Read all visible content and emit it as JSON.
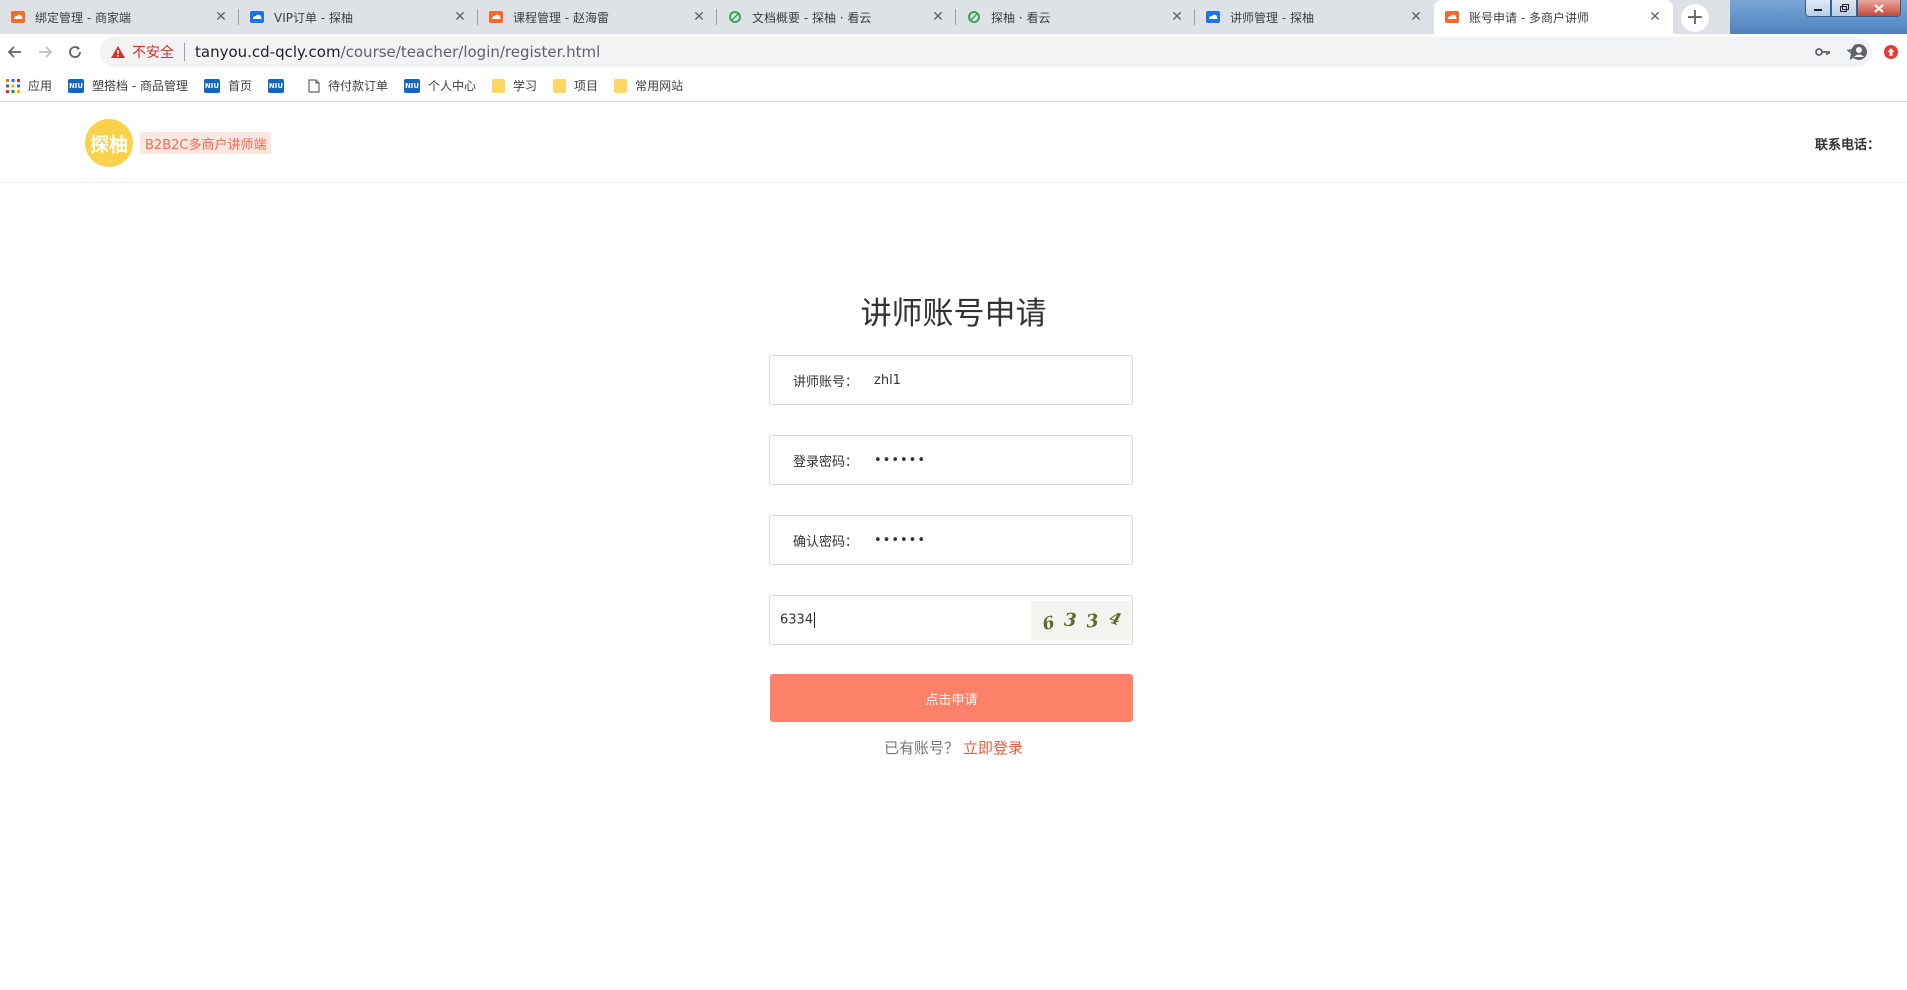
{
  "browser": {
    "tabs": [
      {
        "title": "绑定管理 - 商家端",
        "icon": "orange-cloud-icon",
        "active": false
      },
      {
        "title": "VIP订单 - 探柚",
        "icon": "blue-cloud-icon",
        "active": false
      },
      {
        "title": "课程管理 - 赵海雷",
        "icon": "orange-cloud-icon",
        "active": false
      },
      {
        "title": "文档概要 - 探柚 · 看云",
        "icon": "green-leaf-icon",
        "active": false
      },
      {
        "title": "探柚 · 看云",
        "icon": "green-leaf-icon",
        "active": false
      },
      {
        "title": "讲师管理 - 探柚",
        "icon": "blue-cloud-icon",
        "active": false
      },
      {
        "title": "账号申请 - 多商户讲师",
        "icon": "orange-cloud-icon",
        "active": true
      }
    ],
    "tab_close_symbol": "✕",
    "new_tab_symbol": "+",
    "address": {
      "security_label": "不安全",
      "host": "tanyou.cd-qcly.com",
      "path": "/course/teacher/login/register.html"
    },
    "bookmarks": [
      {
        "label": "应用",
        "icon": "apps-grid-icon"
      },
      {
        "label": "塑搭档 - 商品管理",
        "icon": "niu-icon"
      },
      {
        "label": "首页",
        "icon": "niu-icon"
      },
      {
        "label": "",
        "icon": "niu-icon"
      },
      {
        "label": "待付款订单",
        "icon": "page-icon"
      },
      {
        "label": "个人中心",
        "icon": "niu-icon"
      },
      {
        "label": "学习",
        "icon": "folder-icon"
      },
      {
        "label": "项目",
        "icon": "folder-icon"
      },
      {
        "label": "常用网站",
        "icon": "folder-icon"
      }
    ],
    "niu_badge": "NIU"
  },
  "site": {
    "logo_text": "探柚",
    "logo_tag": "B2B2C多商户讲师端",
    "contact_label": "联系电话："
  },
  "form": {
    "title": "讲师账号申请",
    "account_label": "讲师账号：",
    "account_value": "zhl1",
    "password_label": "登录密码：",
    "password_value": "••••••",
    "confirm_label": "确认密码：",
    "confirm_value": "••••••",
    "captcha_value": "6334",
    "captcha_chars": [
      "6",
      "3",
      "3",
      "4"
    ],
    "submit_label": "点击申请",
    "have_account_text": "已有账号？",
    "login_link": "立即登录"
  },
  "colors": {
    "accent": "#fd8068",
    "link": "#f2593f",
    "logo_bg": "#fcd14a",
    "tag_bg": "#fde7e1",
    "tag_text": "#f26a4f",
    "warning": "#d93025"
  }
}
